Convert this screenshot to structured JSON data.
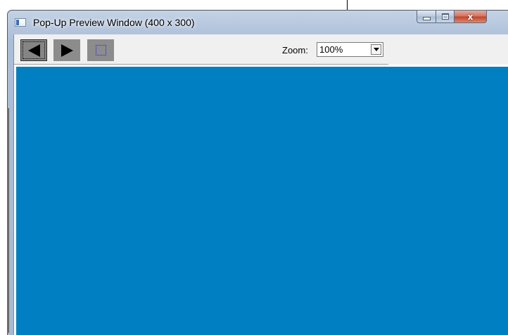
{
  "window": {
    "title": "Pop-Up Preview Window (400 x 300)"
  },
  "caption_buttons": {
    "minimize_icon": "minimize-icon",
    "maximize_icon": "maximize-icon",
    "close_label": "x"
  },
  "toolbar": {
    "back_icon": "triangle-left-icon",
    "forward_icon": "triangle-right-icon",
    "select_icon": "dotted-square-icon",
    "zoom_label": "Zoom:",
    "zoom_value": "100%"
  },
  "canvas": {
    "color": "#0080c2"
  }
}
